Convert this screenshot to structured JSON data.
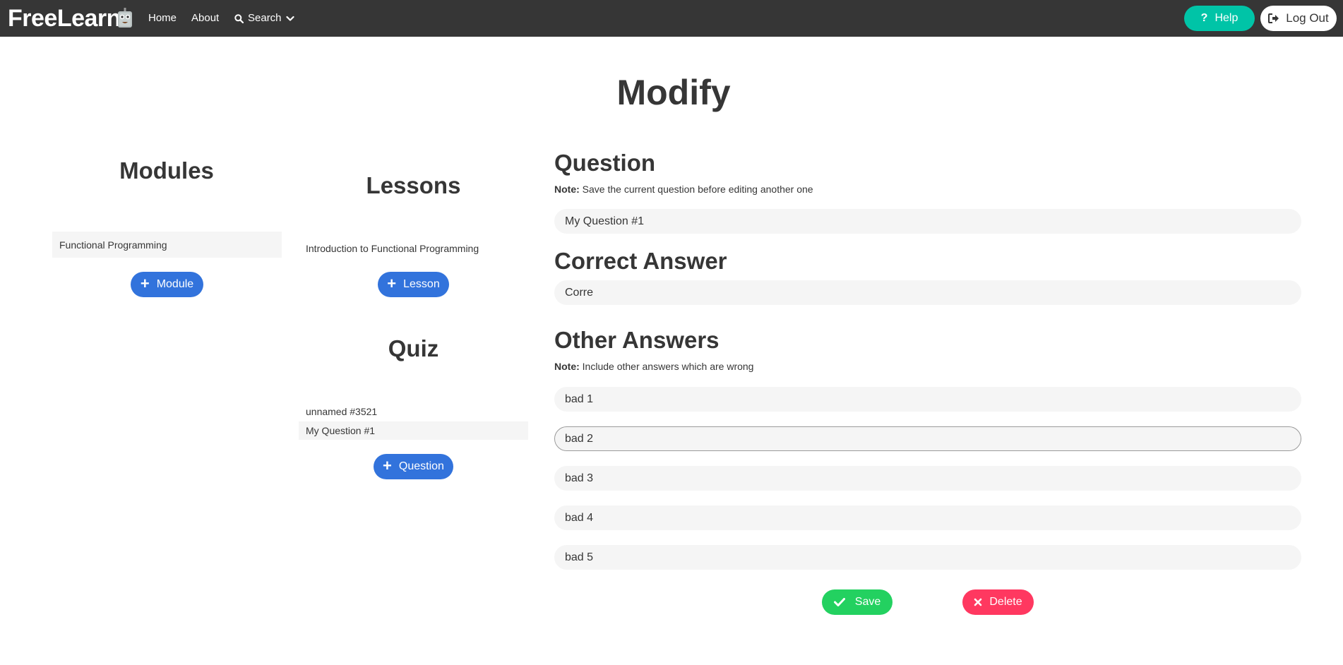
{
  "nav": {
    "brand": "FreeLearn",
    "home": "Home",
    "about": "About",
    "search": "Search",
    "help": "Help",
    "logout": "Log Out"
  },
  "page": {
    "title": "Modify"
  },
  "modules": {
    "heading": "Modules",
    "items": [
      "Functional Programming"
    ],
    "add_label": "Module"
  },
  "lessons": {
    "heading": "Lessons",
    "items": [
      "Introduction to Functional Programming"
    ],
    "add_label": "Lesson"
  },
  "quiz": {
    "heading": "Quiz",
    "items": [
      "unnamed #3521",
      "My Question #1"
    ],
    "add_label": "Question"
  },
  "editor": {
    "question_heading": "Question",
    "question_note_label": "Note:",
    "question_note": "Save the current question before editing another one",
    "question_value": "My Question #1",
    "correct_heading": "Correct Answer",
    "correct_value": "Corre",
    "other_heading": "Other Answers",
    "other_note_label": "Note:",
    "other_note": "Include other answers which are wrong",
    "other_values": [
      "bad 1",
      "bad 2",
      "bad 3",
      "bad 4",
      "bad 5"
    ],
    "save_label": "Save",
    "delete_label": "Delete"
  },
  "colors": {
    "navbar": "#363636",
    "help": "#00c4a7",
    "primary": "#3273dc",
    "save": "#23d160",
    "delete": "#ff3860",
    "field": "#f5f5f5"
  }
}
